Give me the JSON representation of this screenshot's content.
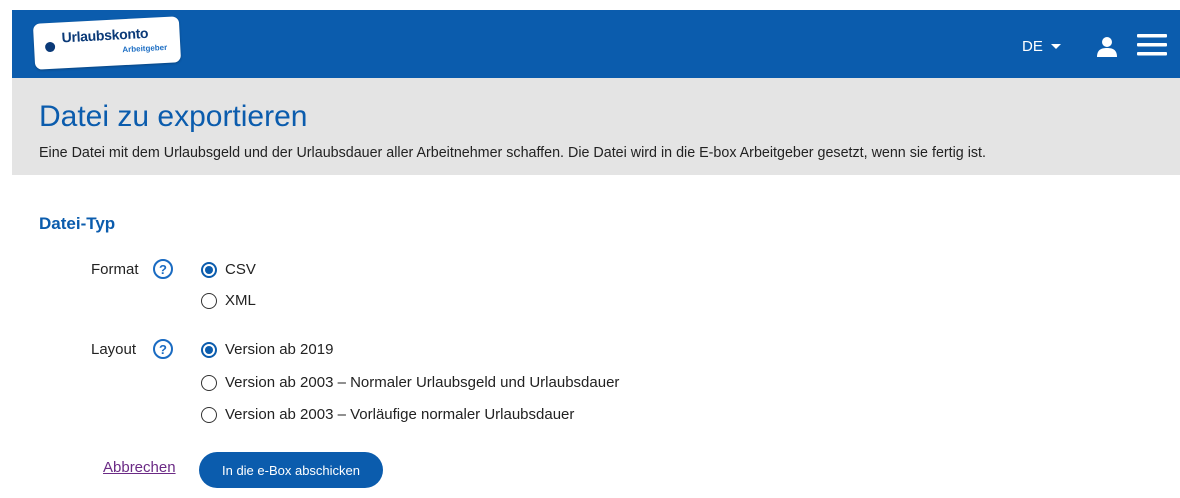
{
  "header": {
    "logo_title": "Urlaubskonto",
    "logo_subtitle": "Arbeitgeber",
    "language": "DE",
    "user_icon": "user-icon",
    "menu_icon": "hamburger-menu-icon",
    "brand_color": "#0b5cad"
  },
  "page": {
    "title": "Datei zu exportieren",
    "subtitle": "Eine Datei mit dem Urlaubsgeld und der Urlaubsdauer aller Arbeitnehmer schaffen. Die Datei wird in die E-box Arbeitgeber gesetzt, wenn sie fertig ist."
  },
  "section": {
    "title": "Datei-Typ"
  },
  "format": {
    "label": "Format",
    "help": "?",
    "options": [
      {
        "label": "CSV",
        "selected": true
      },
      {
        "label": "XML",
        "selected": false
      }
    ]
  },
  "layout": {
    "label": "Layout",
    "help": "?",
    "options": [
      {
        "label": "Version ab 2019",
        "selected": true
      },
      {
        "label": "Version ab 2003 – Normaler Urlaubsgeld und Urlaubsdauer",
        "selected": false
      },
      {
        "label": "Version ab 2003 – Vorläufige normaler Urlaubsdauer",
        "selected": false
      }
    ]
  },
  "actions": {
    "cancel_label": "Abbrechen",
    "submit_label": "In die e-Box abschicken"
  }
}
